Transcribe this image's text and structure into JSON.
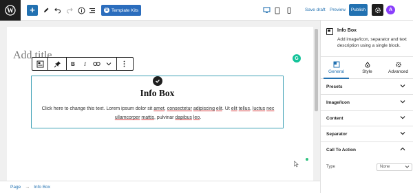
{
  "toolbar": {
    "wp_logo": "wordpress-icon",
    "add_label": "+",
    "template_kits_label": "Template Kits",
    "save_draft_label": "Save draft",
    "preview_label": "Preview",
    "publish_label": "Publish",
    "astra_label": "A"
  },
  "editor": {
    "title_placeholder": "Add title",
    "grammarly_label": "G",
    "block_toolbar": {
      "bold": "B",
      "italic": "I"
    },
    "infobox": {
      "title": "Info Box",
      "description_parts": [
        {
          "t": "Click here to change this text. Lorem ipsum dolor sit ",
          "u": false
        },
        {
          "t": "amet",
          "u": true
        },
        {
          "t": ", ",
          "u": false
        },
        {
          "t": "consectetur",
          "u": true
        },
        {
          "t": " ",
          "u": false
        },
        {
          "t": "adipiscing",
          "u": true
        },
        {
          "t": " ",
          "u": false
        },
        {
          "t": "elit",
          "u": true
        },
        {
          "t": ". Ut ",
          "u": false
        },
        {
          "t": "elit",
          "u": true
        },
        {
          "t": " ",
          "u": false
        },
        {
          "t": "tellus",
          "u": true
        },
        {
          "t": ", ",
          "u": false
        },
        {
          "t": "luctus",
          "u": true
        },
        {
          "t": " ",
          "u": false
        },
        {
          "t": "nec",
          "u": true
        },
        {
          "t": " ",
          "u": false
        },
        {
          "t": "ullamcorper",
          "u": true
        },
        {
          "t": " ",
          "u": false
        },
        {
          "t": "mattis",
          "u": true
        },
        {
          "t": ", pulvinar ",
          "u": false
        },
        {
          "t": "dapibus",
          "u": true
        },
        {
          "t": " ",
          "u": false
        },
        {
          "t": "leo",
          "u": true
        },
        {
          "t": ".",
          "u": false
        }
      ]
    }
  },
  "footer": {
    "crumb_page": "Page",
    "crumb_separator": "→",
    "crumb_block": "Info Box"
  },
  "sidebar": {
    "block_title": "Info Box",
    "block_description": "Add image/icon, separator and text description using a single block.",
    "tabs": [
      {
        "label": "General",
        "icon": "general-icon",
        "active": true
      },
      {
        "label": "Style",
        "icon": "style-icon",
        "active": false
      },
      {
        "label": "Advanced",
        "icon": "advanced-icon",
        "active": false
      }
    ],
    "panels": [
      {
        "label": "Presets",
        "open": false
      },
      {
        "label": "Image/Icon",
        "open": false
      },
      {
        "label": "Content",
        "open": false
      },
      {
        "label": "Separator",
        "open": false
      },
      {
        "label": "Call To Action",
        "open": true
      }
    ],
    "type_label": "Type",
    "type_value": "None"
  },
  "colors": {
    "accent": "#2271b1",
    "selection_border": "#3a9fb4",
    "dark": "#1e1e1e",
    "spellcheck_underline": "#d63638",
    "grammarly": "#15c39a"
  }
}
